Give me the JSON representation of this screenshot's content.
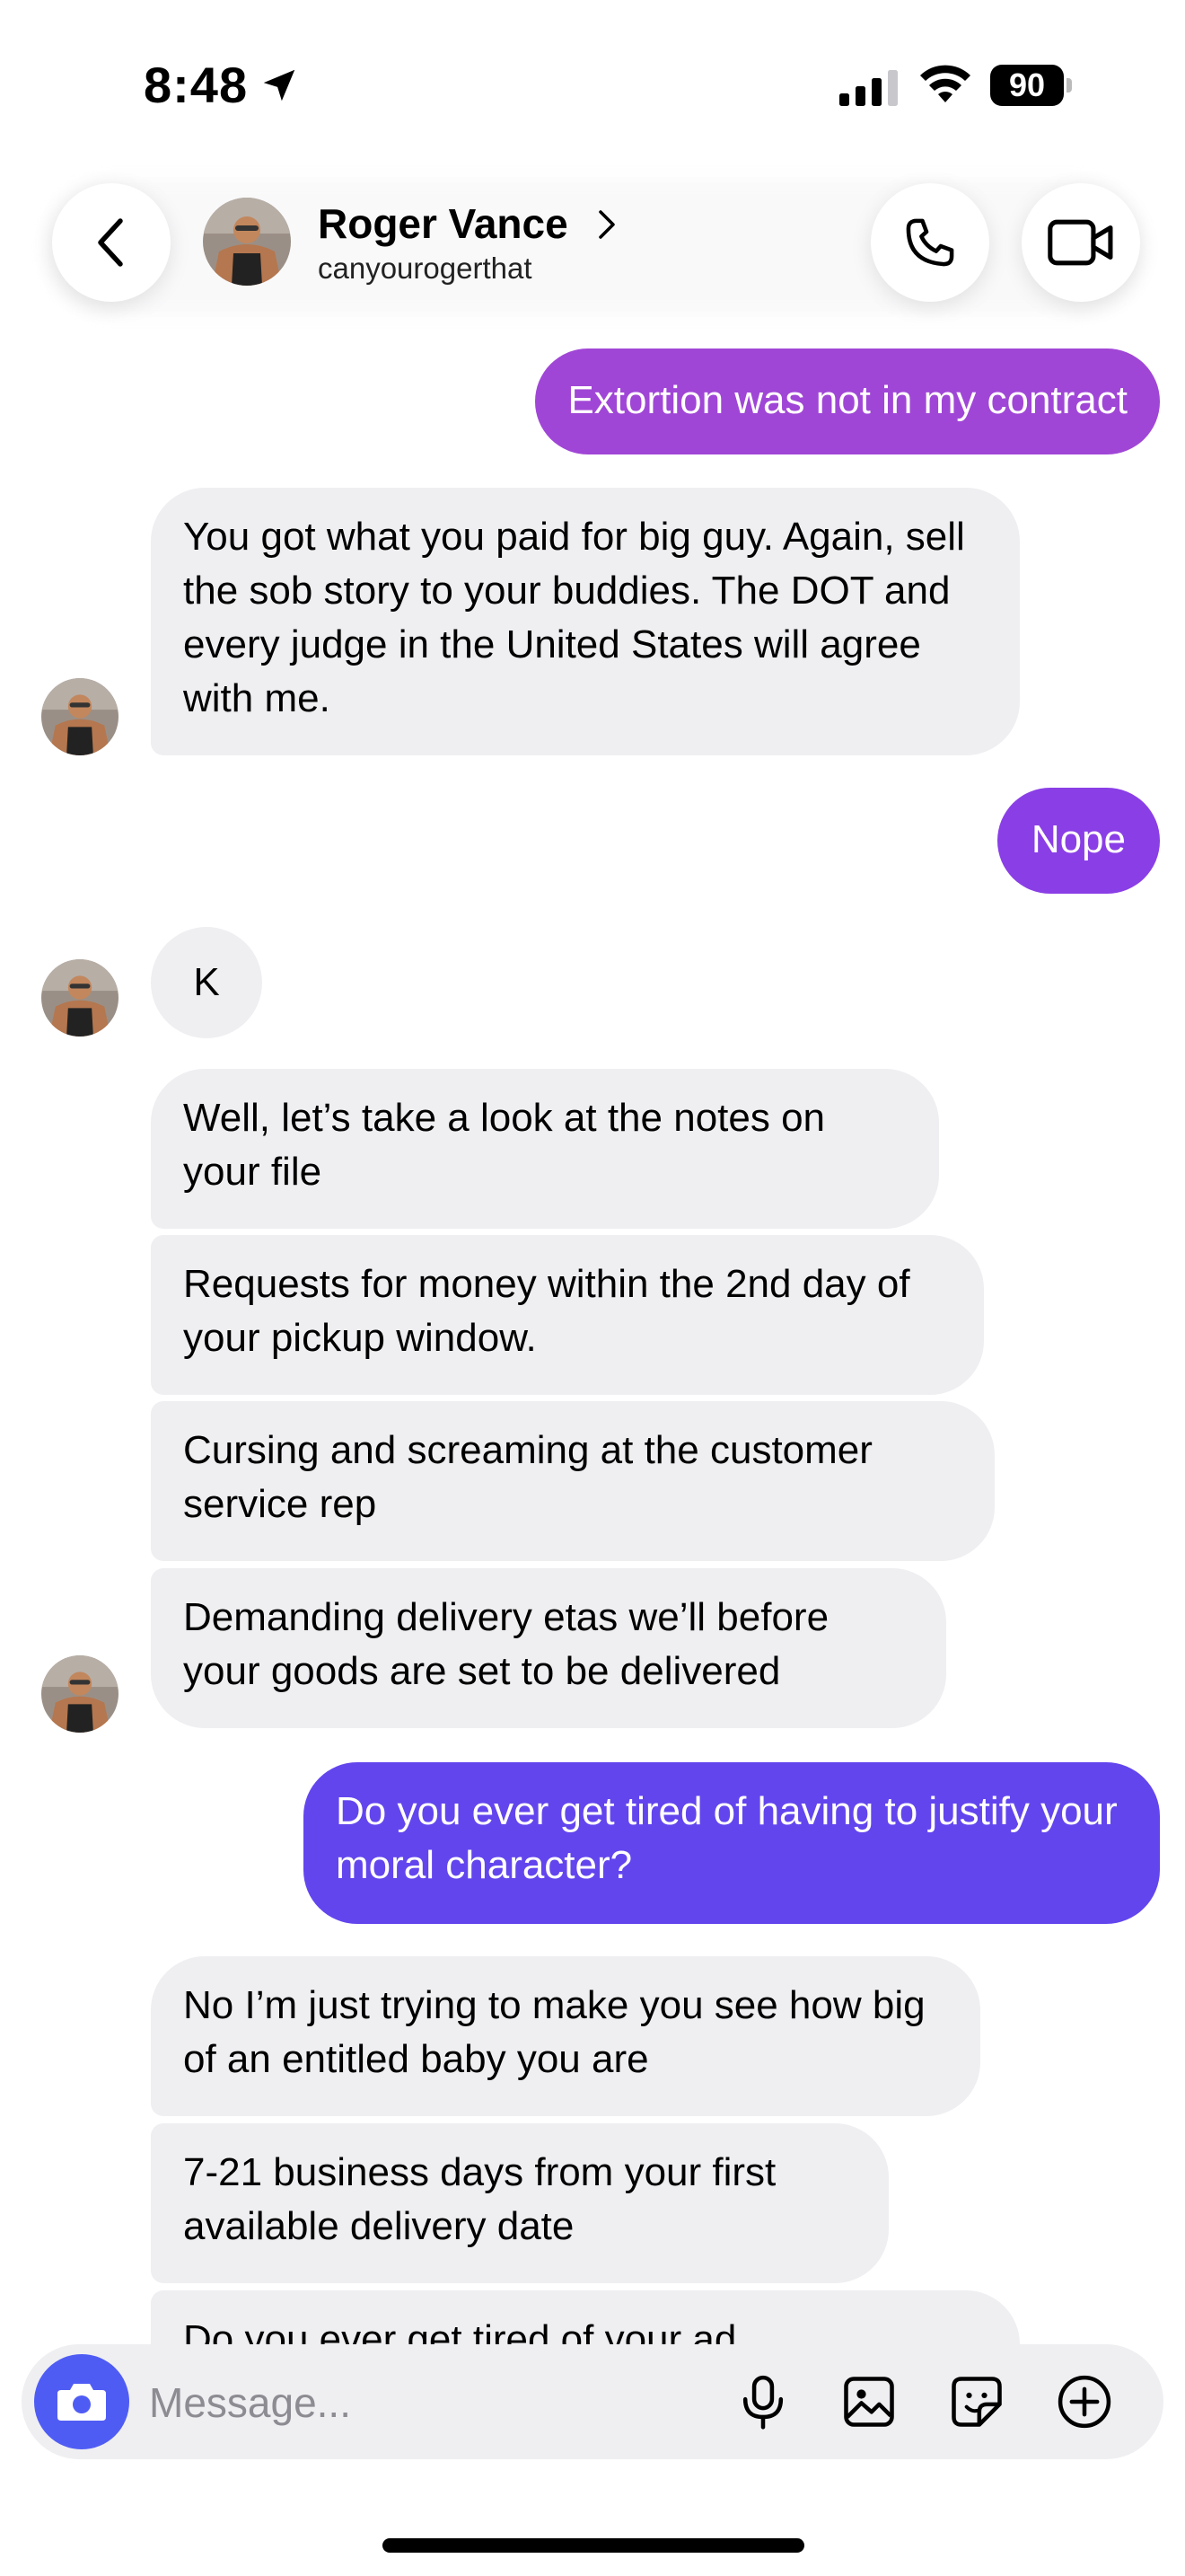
{
  "status_bar": {
    "time": "8:48",
    "battery": "90"
  },
  "header": {
    "name": "Roger Vance",
    "username": "canyourogerthat"
  },
  "messages": [
    {
      "text": "Extortion was not in my contract"
    },
    {
      "text": "You got what you paid for big guy. Again, sell the sob story to your buddies. The DOT and every judge in the United States will agree with me."
    },
    {
      "text": "Nope"
    },
    {
      "text": "K"
    },
    {
      "text": "Well, let’s take a look at the notes on your file"
    },
    {
      "text": "Requests for money within the 2nd day of your pickup window."
    },
    {
      "text": "Cursing and screaming at the customer service rep"
    },
    {
      "text": "Demanding delivery etas we’ll before your goods are set to be delivered"
    },
    {
      "text": "Do you ever get tired of having to justify your moral character?"
    },
    {
      "text": "No I’m just trying to make you see how big of an entitled baby you are"
    },
    {
      "text": "7-21 business days from your first available delivery date"
    },
    {
      "text": "Do you ever get tired of your ad"
    }
  ],
  "composer": {
    "placeholder": "Message..."
  },
  "colors": {
    "out_1": "#a046d6",
    "out_2": "#8a3ee6",
    "out_3": "#6345ee",
    "incoming": "#efeff2",
    "camera": "#4f5cf4"
  },
  "icons": [
    "back-chevron-icon",
    "phone-icon",
    "video-camera-icon",
    "camera-icon",
    "microphone-icon",
    "image-icon",
    "sticker-icon",
    "plus-circle-icon"
  ]
}
